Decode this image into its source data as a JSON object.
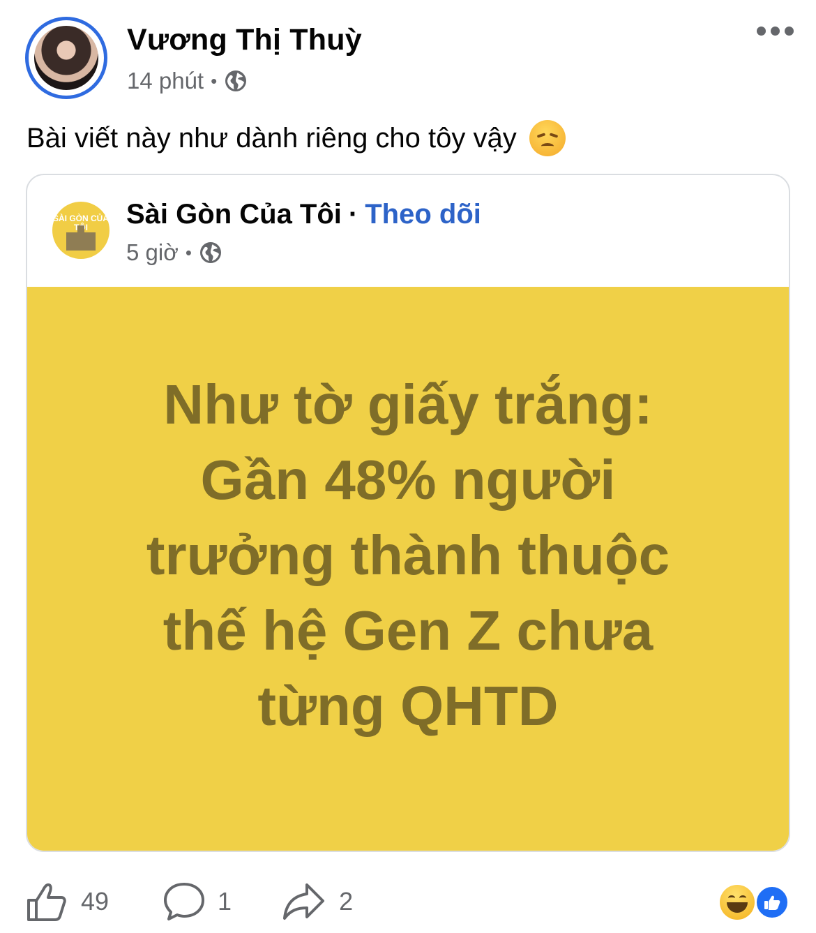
{
  "post": {
    "author": "Vương Thị Thuỳ",
    "time": "14 phút",
    "caption": "Bài viết này như dành riêng cho tôy vậy",
    "caption_emoji": "disappointed-face-emoji"
  },
  "shared": {
    "page_name": "Sài Gòn Của Tôi",
    "separator": "·",
    "follow_label": "Theo dõi",
    "time": "5 giờ",
    "logo_text": "SÀI GÒN CỦA TÔI",
    "poster_lines": [
      "Như tờ giấy trắng:",
      "Gần 48% người",
      "trưởng thành thuộc",
      "thế hệ Gen Z chưa",
      "từng QHTD"
    ],
    "poster_bg": "#f0d047",
    "poster_text_color": "#7f6d28"
  },
  "actions": {
    "like_count": "49",
    "comment_count": "1",
    "share_count": "2"
  },
  "icons": {
    "more": "more-horizontal-icon",
    "audience": "globe-icon",
    "like": "thumbs-up-icon",
    "comment": "comment-bubble-icon",
    "share": "share-arrow-icon",
    "reactions": [
      "haha-reaction-icon",
      "like-reaction-icon"
    ]
  },
  "colors": {
    "ring": "#2f6be0",
    "follow": "#2d63c8",
    "secondary_text": "#65676b",
    "like_badge": "#1f6ef5"
  }
}
